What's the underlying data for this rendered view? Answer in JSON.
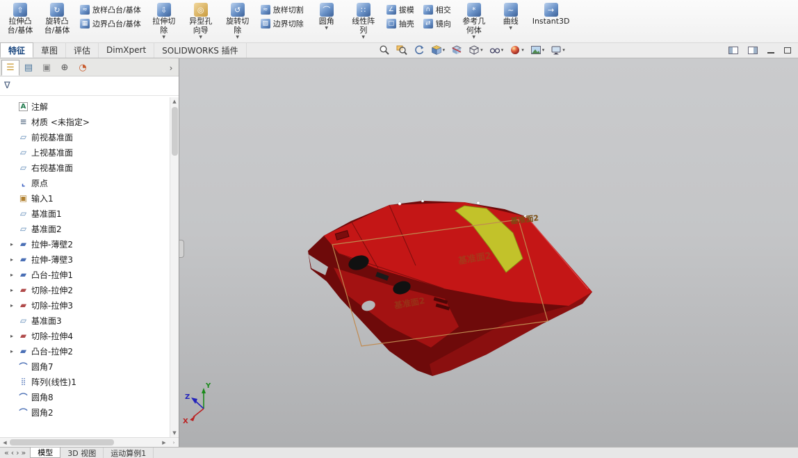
{
  "ribbon": {
    "groups": [
      {
        "type": "large",
        "line1": "拉伸凸",
        "line2": "台/基体",
        "icon": "extrude-boss"
      },
      {
        "type": "large",
        "line1": "旋转凸",
        "line2": "台/基体",
        "icon": "revolve-boss"
      },
      {
        "type": "stack",
        "items": [
          {
            "label": "放样凸台/基体",
            "icon": "loft-boss"
          },
          {
            "label": "边界凸台/基体",
            "icon": "boundary-boss"
          }
        ]
      },
      {
        "type": "large",
        "line1": "拉伸切",
        "line2": "除",
        "icon": "extrude-cut",
        "dropdown": "▼"
      },
      {
        "type": "large",
        "line1": "异型孔",
        "line2": "向导",
        "icon": "hole-wizard",
        "dropdown": "▼"
      },
      {
        "type": "large",
        "line1": "旋转切",
        "line2": "除",
        "icon": "revolve-cut",
        "dropdown": "▼"
      },
      {
        "type": "stack",
        "items": [
          {
            "label": "放样切割",
            "icon": "loft-cut"
          },
          {
            "label": "边界切除",
            "icon": "boundary-cut"
          }
        ]
      },
      {
        "type": "large",
        "line1": "圆角",
        "line2": "",
        "icon": "fillet",
        "dropdown": "▼"
      },
      {
        "type": "large",
        "line1": "线性阵",
        "line2": "列",
        "icon": "linear-pattern",
        "dropdown": "▼"
      },
      {
        "type": "stack",
        "items": [
          {
            "label": "拔模",
            "icon": "draft"
          },
          {
            "label": "抽壳",
            "icon": "shell"
          }
        ]
      },
      {
        "type": "stack",
        "items": [
          {
            "label": "相交",
            "icon": "intersect"
          },
          {
            "label": "镜向",
            "icon": "mirror"
          }
        ]
      },
      {
        "type": "large",
        "line1": "参考几",
        "line2": "何体",
        "icon": "ref-geometry",
        "dropdown": "▼"
      },
      {
        "type": "large",
        "line1": "曲线",
        "line2": "",
        "icon": "curves",
        "dropdown": "▼"
      },
      {
        "type": "large",
        "line1": "Instant3D",
        "line2": "",
        "icon": "instant3d"
      }
    ]
  },
  "tabs": [
    {
      "label": "特征",
      "active": true
    },
    {
      "label": "草图"
    },
    {
      "label": "评估"
    },
    {
      "label": "DimXpert"
    },
    {
      "label": "SOLIDWORKS 插件"
    }
  ],
  "viewbar": {
    "icons": [
      "zoom-fit",
      "zoom-area",
      "previous-view",
      "view-orientation",
      "section-view",
      "display-style",
      "hide-show-items",
      "edit-appearance",
      "apply-scene",
      "view-settings"
    ]
  },
  "panel": {
    "tree": {
      "items": [
        {
          "label": "注解",
          "icon": "annotations"
        },
        {
          "label": "材质 <未指定>",
          "icon": "material"
        },
        {
          "label": "前视基准面",
          "icon": "plane"
        },
        {
          "label": "上视基准面",
          "icon": "plane"
        },
        {
          "label": "右视基准面",
          "icon": "plane"
        },
        {
          "label": "原点",
          "icon": "origin"
        },
        {
          "label": "输入1",
          "icon": "imported"
        },
        {
          "label": "基准面1",
          "icon": "plane"
        },
        {
          "label": "基准面2",
          "icon": "plane"
        },
        {
          "label": "拉伸-薄壁2",
          "icon": "extrude",
          "arrow": "▸"
        },
        {
          "label": "拉伸-薄壁3",
          "icon": "extrude",
          "arrow": "▸"
        },
        {
          "label": "凸台-拉伸1",
          "icon": "extrude",
          "arrow": "▸"
        },
        {
          "label": "切除-拉伸2",
          "icon": "cut",
          "arrow": "▸"
        },
        {
          "label": "切除-拉伸3",
          "icon": "cut",
          "arrow": "▸"
        },
        {
          "label": "基准面3",
          "icon": "plane"
        },
        {
          "label": "切除-拉伸4",
          "icon": "cut",
          "arrow": "▸"
        },
        {
          "label": "凸台-拉伸2",
          "icon": "extrude",
          "arrow": "▸"
        },
        {
          "label": "圆角7",
          "icon": "fillet"
        },
        {
          "label": "阵列(线性)1",
          "icon": "pattern"
        },
        {
          "label": "圆角8",
          "icon": "fillet"
        },
        {
          "label": "圆角2",
          "icon": "fillet"
        }
      ]
    }
  },
  "viewport": {
    "plane_label": "基准面2",
    "triad": {
      "x": "X",
      "y": "Y",
      "z": "Z"
    },
    "colors": {
      "silhouette": "#6e0a0a",
      "body": "#c41616",
      "front": "#a31212",
      "side": "#8a0f0f",
      "stripe": "#c2c22a",
      "stripe_edge": "#8a8a14",
      "line": "#7a0d0d",
      "edge_light": "#d84848",
      "plane_edge": "#c08a50",
      "plane_text": "#7a4e14"
    }
  },
  "statusbar": {
    "tabs": [
      {
        "label": "模型",
        "active": true
      },
      {
        "label": "3D 视图"
      },
      {
        "label": "运动算例1"
      }
    ]
  }
}
